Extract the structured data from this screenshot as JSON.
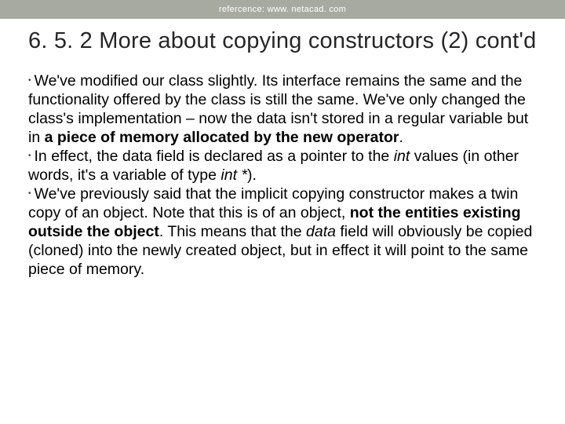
{
  "header": {
    "reference": "refercence: www. netacad. com"
  },
  "title": "6. 5. 2 More about copying constructors (2) cont'd",
  "bullets": [
    {
      "pre": "We've modified our class slightly. Its interface remains the same and the functionality offered by the class is still the same. We've only changed the class's implementation – now the data isn't stored in a regular variable but in ",
      "bold1": "a piece of memory allocated by the new operator",
      "post1": "."
    },
    {
      "pre": "In effect, the data field is declared as a pointer to the ",
      "it1": "int",
      "mid1": " values (in other words, it's a variable of type ",
      "it2": "int *",
      "post1": ")."
    },
    {
      "pre": "We've previously said that the implicit copying constructor makes a twin copy of an object. Note that this is of an object, ",
      "bold1": "not the entities existing outside the object",
      "mid1": ". This means that the ",
      "it1": "data",
      "post1": " field will obviously be copied (cloned) into the newly created object, but in effect it will point to the same piece of memory."
    }
  ]
}
